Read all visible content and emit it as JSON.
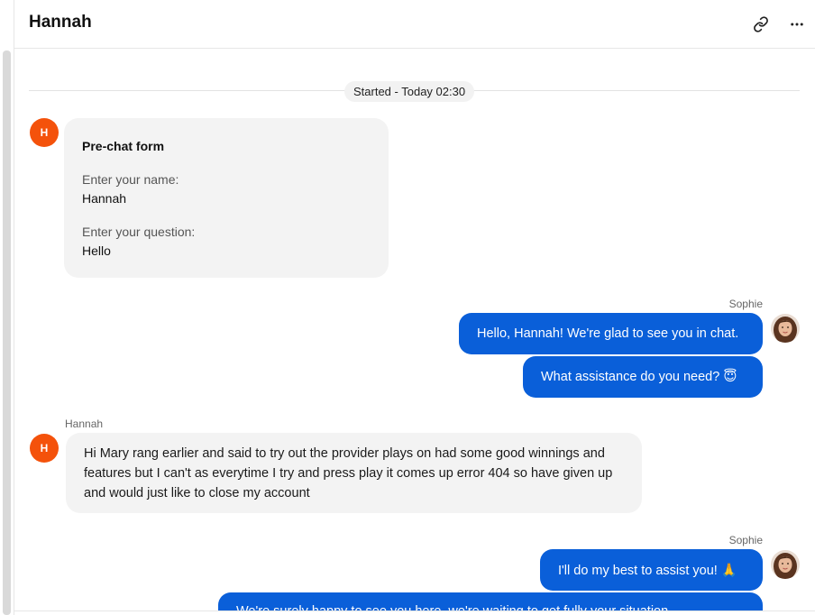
{
  "header": {
    "title": "Hannah",
    "link_icon": "link-icon",
    "more_icon": "more-horizontal-icon"
  },
  "chat": {
    "started_label": "Started - Today 02:30",
    "prechat": {
      "avatar_initial": "H",
      "title": "Pre-chat form",
      "name_label": "Enter your name:",
      "name_value": "Hannah",
      "question_label": "Enter your question:",
      "question_value": "Hello"
    },
    "messages": [
      {
        "sender": "Sophie",
        "texts": [
          "Hello, Hannah! We're glad to see you in chat.",
          "What assistance do you need? 😇"
        ]
      },
      {
        "sender": "Hannah",
        "avatar_initial": "H",
        "texts": [
          "Hi Mary rang earlier and said to try out the provider plays on had some good winnings and features but I can't as everytime I try and press play it comes up error 404 so have given up and would just like to close my account"
        ]
      },
      {
        "sender": "Sophie",
        "texts": [
          "I'll do my best to assist you! 🙏",
          "We're surely happy to see you here, we're waiting to get fully your situation"
        ]
      }
    ]
  },
  "colors": {
    "agent_bubble": "#0a5fd9",
    "user_bubble": "#f3f3f3",
    "avatar_orange": "#f4520b"
  }
}
